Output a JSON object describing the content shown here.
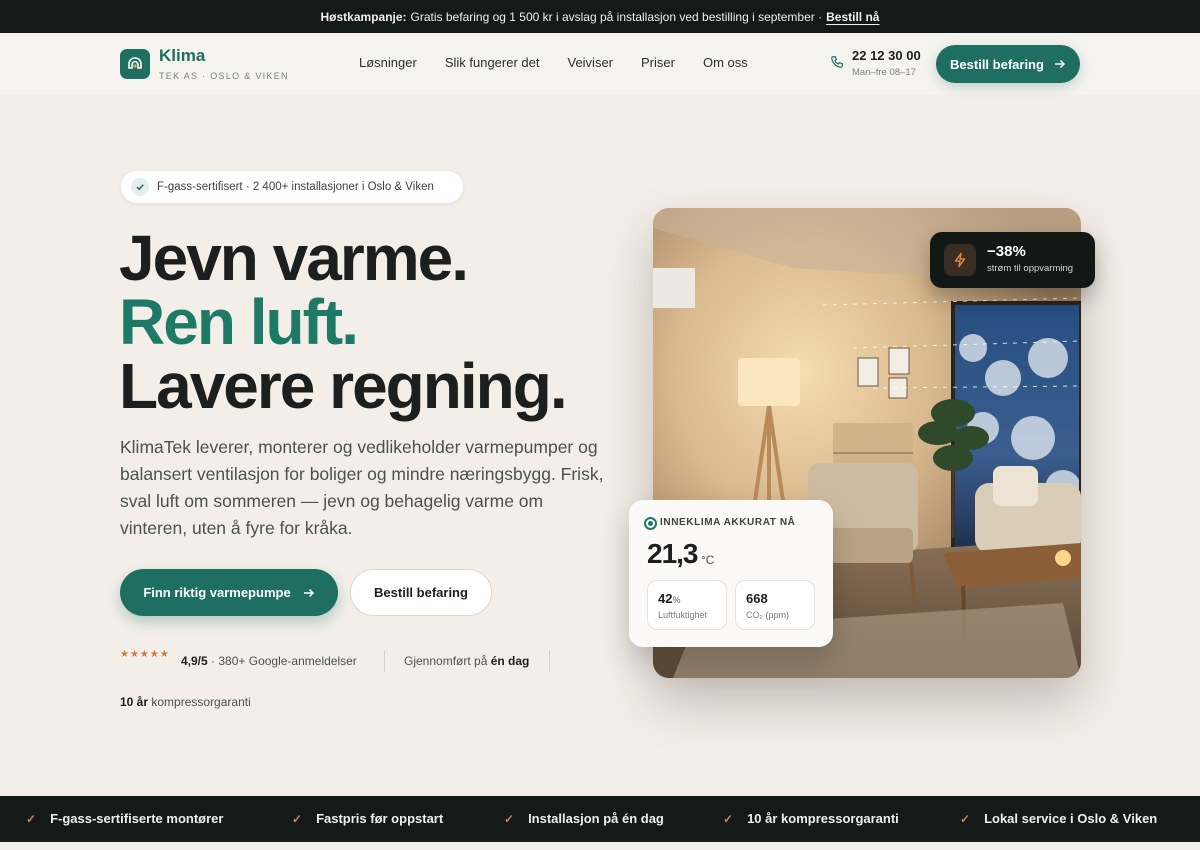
{
  "announcement": {
    "prefix": "Høstkampanje:",
    "text": "Gratis befaring og 1 500 kr i avslag på installasjon ved bestilling i september ·",
    "link": "Bestill nå"
  },
  "brand": {
    "name": "Klima",
    "subtitle": "TEK AS · OSLO & VIKEN",
    "accent": "#1e6f62"
  },
  "nav": {
    "items": [
      "Løsninger",
      "Slik fungerer det",
      "Veiviser",
      "Priser",
      "Om oss"
    ]
  },
  "contact": {
    "phone": "22 12 30 00",
    "hours": "Man–fre 08–17",
    "cta": "Bestill befaring"
  },
  "hero": {
    "badge": "F-gass-sertifisert · 2 400+ installasjoner i Oslo & Viken",
    "headline_1": "Jevn varme.",
    "headline_2": "Ren luft.",
    "headline_3": "Lavere regning.",
    "lead": "KlimaTek leverer, monterer og vedlikeholder varmepumper og balansert ventilasjon for boliger og mindre næringsbygg. Frisk, sval luft om sommeren — jevn og behagelig varme om vinteren, uten å fyre for kråka.",
    "primary_cta": "Finn riktig varmepumpe",
    "secondary_cta": "Bestill befaring",
    "stars": "★★★★★",
    "rating_score": "4,9/5",
    "rating_text": "· 380+ Google-anmeldelser",
    "done_prefix": "Gjennomført på",
    "done_bold": "én dag",
    "warranty_bold": "10 år",
    "warranty_text": "kompressorgaranti"
  },
  "savings_tag": {
    "value": "−38%",
    "label": "strøm til oppvarming"
  },
  "climate_card": {
    "title": "INNEKLIMA AKKURAT NÅ",
    "temperature": "21,3",
    "temp_unit": "°C",
    "humidity_value": "42",
    "humidity_unit": "%",
    "humidity_label": "Luftfuktighet",
    "co2_value": "668",
    "co2_label": "CO₂ (ppm)"
  },
  "trust_bar": {
    "items": [
      "F-gass-sertifiserte montører",
      "Fastpris før oppstart",
      "Installasjon på én dag",
      "10 år kompressorgaranti",
      "Lokal service i Oslo & Viken"
    ]
  }
}
